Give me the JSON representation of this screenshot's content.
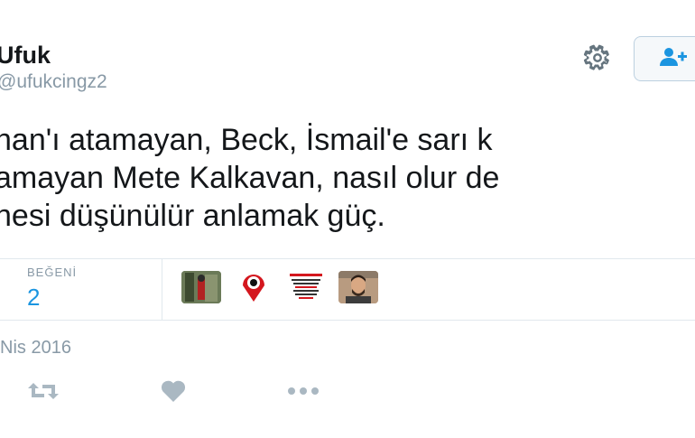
{
  "user": {
    "name": "Ufuk",
    "handle": "@ufukcingz2"
  },
  "tweet": {
    "lines": [
      "han'ı atamayan, Beck, İsmail'e sarı k",
      "amayan Mete Kalkavan, nasıl olur de",
      "nesi düşünülür anlamak güç."
    ]
  },
  "stats": {
    "likes_label": "BEĞENİ",
    "likes_count": "2"
  },
  "avatars": [
    {
      "name": "avatar-1"
    },
    {
      "name": "avatar-2"
    },
    {
      "name": "avatar-3"
    },
    {
      "name": "avatar-4"
    }
  ],
  "date": "Nis 2016",
  "icons": {
    "settings": "gear-icon",
    "follow": "follow-user-icon",
    "retweet": "retweet-icon",
    "like": "heart-icon",
    "more": "more-icon"
  },
  "colors": {
    "accent": "#1b95e0",
    "muted": "#8899a6",
    "text": "#14171a",
    "border": "#e1e8ed"
  }
}
